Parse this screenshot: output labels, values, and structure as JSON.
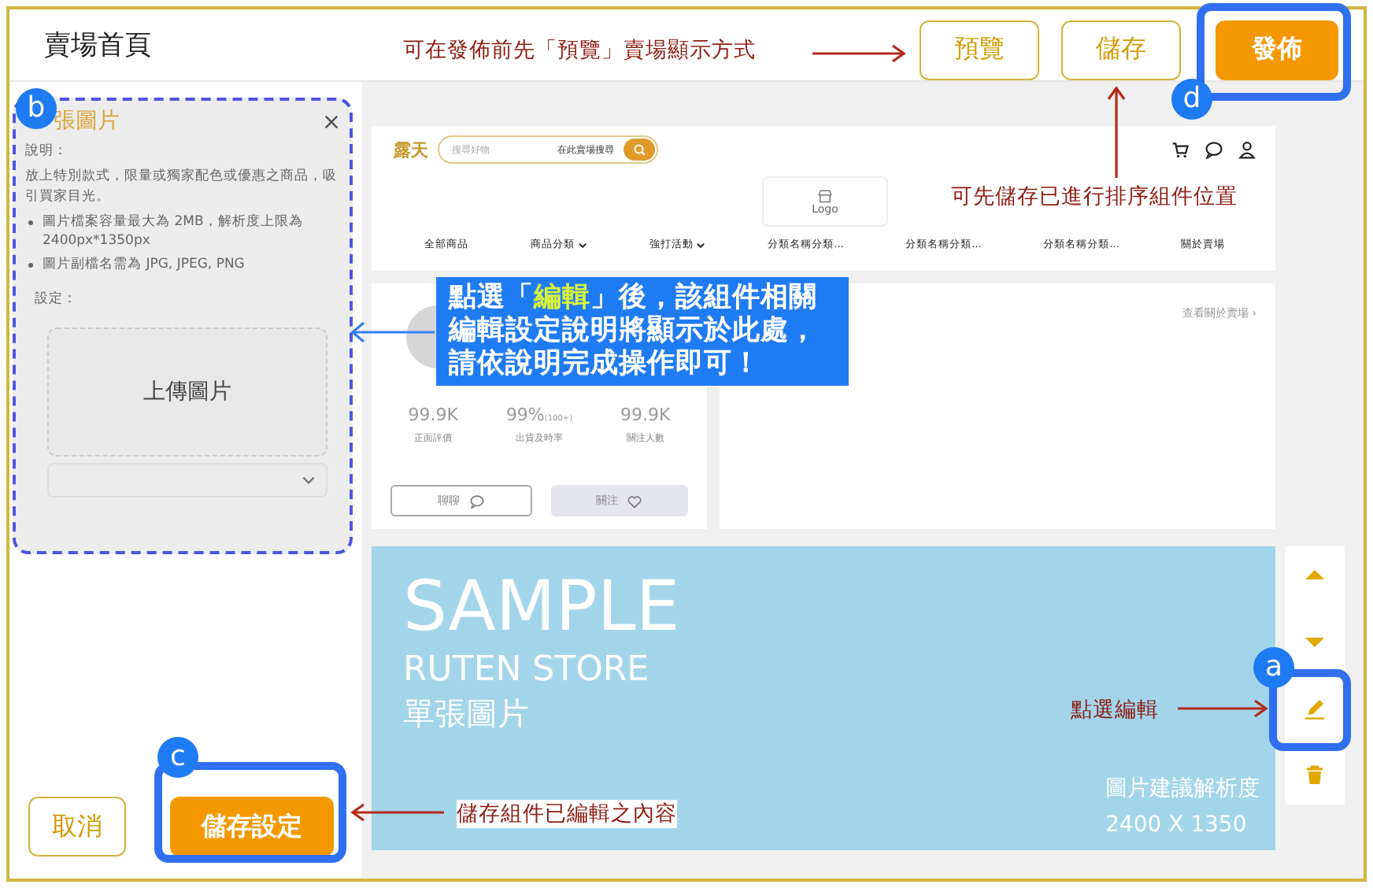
{
  "header": {
    "title": "賣場首頁",
    "buttons": [
      {
        "label": "預覽",
        "kind": "outline"
      },
      {
        "label": "儲存",
        "kind": "outline"
      },
      {
        "label": "發佈",
        "kind": "primary"
      }
    ]
  },
  "help_panel": {
    "title": "張圖片",
    "heading": "說明：",
    "intro": "放上特別款式，限量或獨家配色或優惠之商品，吸引買家目光。",
    "bullets": [
      "圖片檔案容量最大為 2MB，解析度上限為 2400px*1350px",
      "圖片副檔名需為 JPG, JPEG, PNG"
    ],
    "settings_label": "設定：",
    "upload_label": "上傳圖片"
  },
  "footer_buttons": [
    {
      "label": "取消",
      "kind": "outline"
    },
    {
      "label": "儲存設定",
      "kind": "primary"
    }
  ],
  "store_preview": {
    "brand": "露天",
    "search_placeholder": "搜尋好物",
    "search_scope": "在此賣場搜尋",
    "logo": "Logo",
    "nav": [
      {
        "label": "全部商品",
        "dropdown": false
      },
      {
        "label": "商品分類",
        "dropdown": true
      },
      {
        "label": "強打活動",
        "dropdown": true
      },
      {
        "label": "分類名稱分類...",
        "dropdown": false
      },
      {
        "label": "分類名稱分類...",
        "dropdown": false
      },
      {
        "label": "分類名稱分類...",
        "dropdown": false
      },
      {
        "label": "關於賣場",
        "dropdown": false
      }
    ],
    "stats": [
      {
        "value": "99.9K",
        "label": "正面評價"
      },
      {
        "value": "99%",
        "suffix": "(100+)",
        "label": "出貨及時率"
      },
      {
        "value": "99.9K",
        "label": "關注人數"
      }
    ],
    "chat_button": "聊聊",
    "follow_button": "關注",
    "about_link": "查看關於賣場 ›"
  },
  "banner": {
    "title": "SAMPLE",
    "subtitle": "RUTEN STORE",
    "caption": "單張圖片",
    "note_label": "圖片建議解析度",
    "note_value": "2400 X 1350"
  },
  "tools": [
    {
      "kind": "up"
    },
    {
      "kind": "down"
    },
    {
      "kind": "edit"
    },
    {
      "kind": "delete"
    }
  ],
  "badges": [
    "a",
    "b",
    "c",
    "d"
  ],
  "notes": [
    {
      "kind": "red",
      "text": "可在發佈前先「預覽」賣場顯示方式"
    },
    {
      "kind": "red",
      "text": "可先儲存已進行排序組件位置"
    },
    {
      "kind": "blue",
      "text": "點選「**編輯**」後，該組件相關編輯設定說明將顯示於此處，請依說明完成操作即可！"
    },
    {
      "kind": "red",
      "text": "點選編輯"
    },
    {
      "kind": "red",
      "text": "儲存組件已編輯之內容"
    }
  ]
}
